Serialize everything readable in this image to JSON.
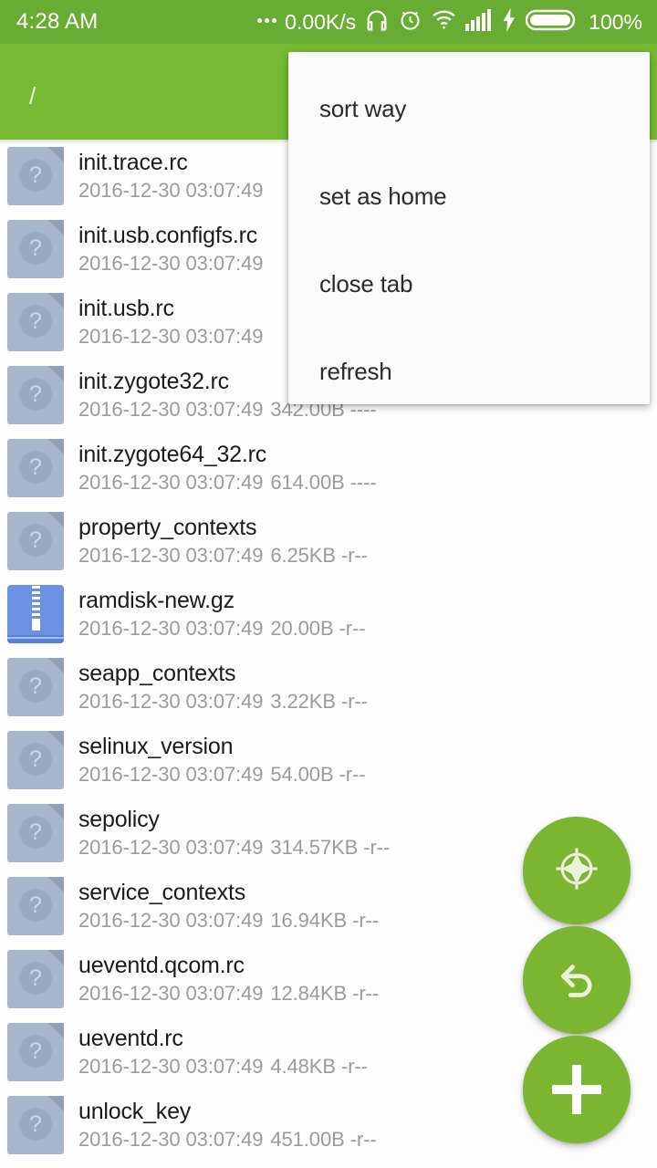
{
  "status_bar": {
    "clock": "4:28 AM",
    "network_speed": "0.00K/s",
    "battery_percent": "100%",
    "icons": [
      "more-dots-icon",
      "headphones-icon",
      "alarm-clock-icon",
      "wifi-icon",
      "cellular-signal-icon",
      "charging-bolt-icon",
      "battery-icon"
    ],
    "background_color": "#68ac34"
  },
  "toolbar": {
    "path": "/",
    "background_color": "#76ba32"
  },
  "popup_menu": {
    "items": [
      {
        "label": "sort way"
      },
      {
        "label": "set as home"
      },
      {
        "label": "close tab"
      },
      {
        "label": "refresh"
      }
    ],
    "background_color": "#fafafa"
  },
  "file_list": {
    "rows": [
      {
        "name": "init.trace.rc",
        "date": "2016-12-30 03:07:49",
        "size": "",
        "perm": "",
        "icon": "unknown-file-icon"
      },
      {
        "name": "init.usb.configfs.rc",
        "date": "2016-12-30 03:07:49",
        "size": "",
        "perm": "",
        "icon": "unknown-file-icon"
      },
      {
        "name": "init.usb.rc",
        "date": "2016-12-30 03:07:49",
        "size": "",
        "perm": "",
        "icon": "unknown-file-icon"
      },
      {
        "name": "init.zygote32.rc",
        "date": "2016-12-30 03:07:49",
        "size": "342.00B",
        "perm": "----",
        "icon": "unknown-file-icon"
      },
      {
        "name": "init.zygote64_32.rc",
        "date": "2016-12-30 03:07:49",
        "size": "614.00B",
        "perm": "----",
        "icon": "unknown-file-icon"
      },
      {
        "name": "property_contexts",
        "date": "2016-12-30 03:07:49",
        "size": "6.25KB",
        "perm": "-r--",
        "icon": "unknown-file-icon"
      },
      {
        "name": "ramdisk-new.gz",
        "date": "2016-12-30 03:07:49",
        "size": "20.00B",
        "perm": "-r--",
        "icon": "archive-file-icon"
      },
      {
        "name": "seapp_contexts",
        "date": "2016-12-30 03:07:49",
        "size": "3.22KB",
        "perm": "-r--",
        "icon": "unknown-file-icon"
      },
      {
        "name": "selinux_version",
        "date": "2016-12-30 03:07:49",
        "size": "54.00B",
        "perm": "-r--",
        "icon": "unknown-file-icon"
      },
      {
        "name": "sepolicy",
        "date": "2016-12-30 03:07:49",
        "size": "314.57KB",
        "perm": "-r--",
        "icon": "unknown-file-icon"
      },
      {
        "name": "service_contexts",
        "date": "2016-12-30 03:07:49",
        "size": "16.94KB",
        "perm": "-r--",
        "icon": "unknown-file-icon"
      },
      {
        "name": "ueventd.qcom.rc",
        "date": "2016-12-30 03:07:49",
        "size": "12.84KB",
        "perm": "-r--",
        "icon": "unknown-file-icon"
      },
      {
        "name": "ueventd.rc",
        "date": "2016-12-30 03:07:49",
        "size": "4.48KB",
        "perm": "-r--",
        "icon": "unknown-file-icon"
      },
      {
        "name": "unlock_key",
        "date": "2016-12-30 03:07:49",
        "size": "451.00B",
        "perm": "-r--",
        "icon": "unknown-file-icon"
      }
    ]
  },
  "fabs": [
    {
      "name": "navigate-fab",
      "icon": "compass-icon"
    },
    {
      "name": "back-fab",
      "icon": "undo-arrow-icon"
    },
    {
      "name": "add-fab",
      "icon": "plus-icon"
    }
  ],
  "colors": {
    "accent_green": "#7cb52f",
    "status_green": "#68ac34",
    "toolbar_green": "#76ba32",
    "file_icon_blue_gray": "#a6b6cd",
    "archive_icon_blue": "#6c90e2"
  }
}
